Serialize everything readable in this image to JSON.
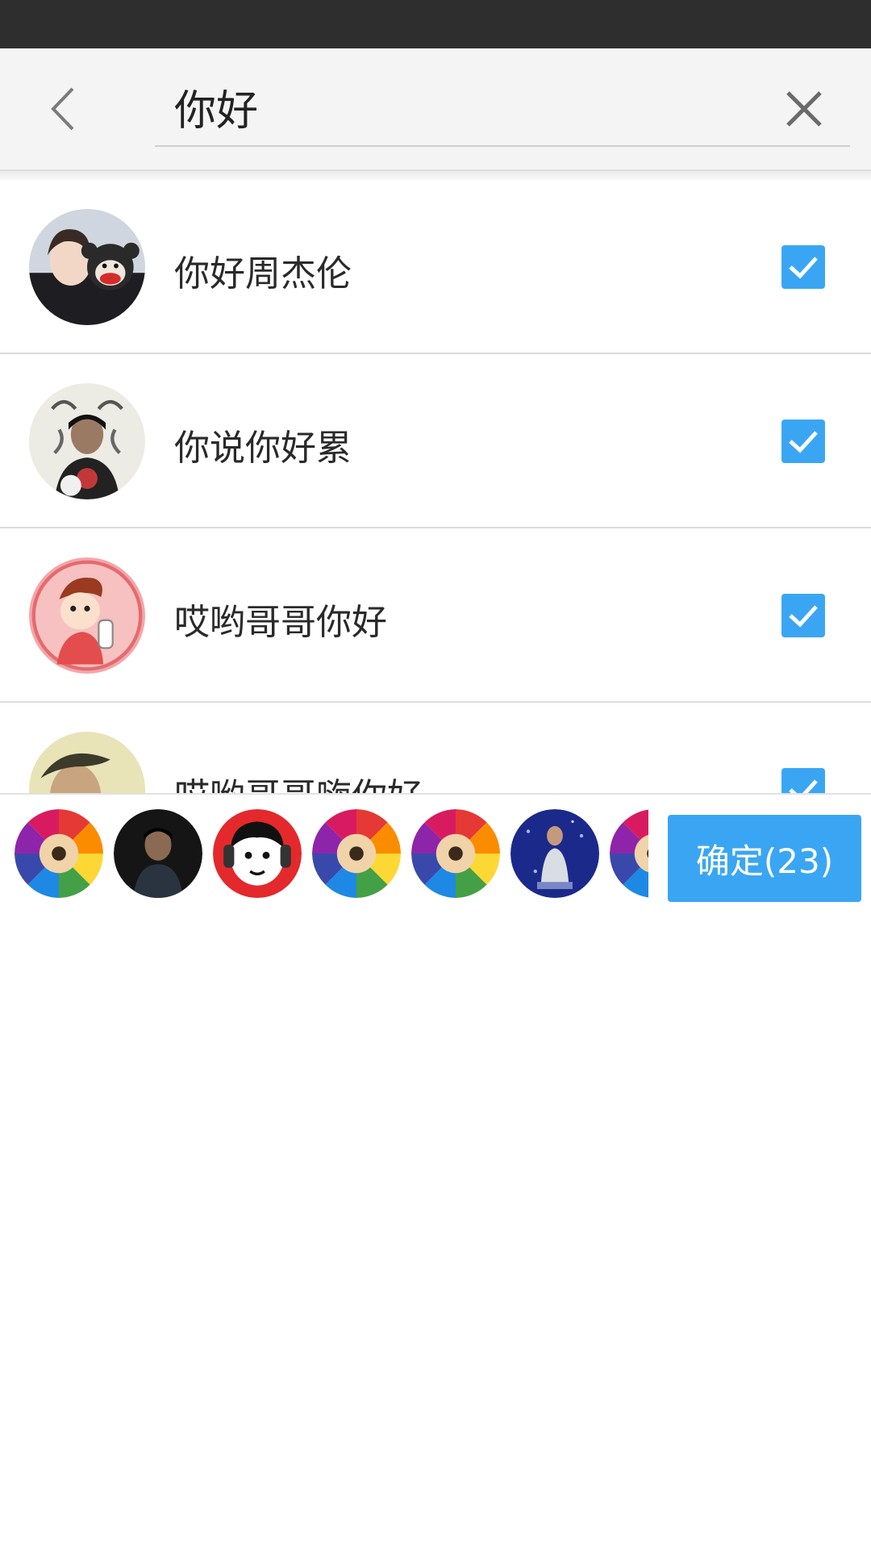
{
  "search": {
    "query": "你好"
  },
  "results": [
    {
      "name": "你好周杰伦",
      "checked": true
    },
    {
      "name": "你说你好累",
      "checked": true
    },
    {
      "name": "哎哟哥哥你好",
      "checked": true
    },
    {
      "name": "哎哟哥哥嗨你好",
      "checked": true
    }
  ],
  "selected_avatars": [
    "pencils-avatar",
    "dark-portrait-avatar",
    "cartoon-headphones-avatar",
    "pencils-avatar",
    "pencils-avatar",
    "stage-performer-avatar",
    "pencils-avatar"
  ],
  "confirm": {
    "label": "确定(23)"
  },
  "colors": {
    "accent": "#3aa6f3",
    "status_bar": "#2e2e2e",
    "search_bg": "#f4f4f4"
  }
}
